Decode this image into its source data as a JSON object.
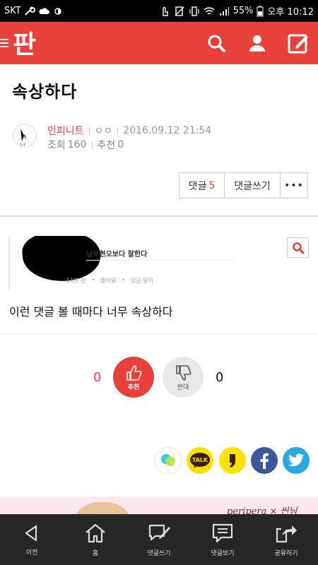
{
  "status_bar": {
    "carrier": "SKT",
    "battery": "55%",
    "time": "오후 10:12"
  },
  "header": {
    "logo_text": "판",
    "icons": [
      "menu-icon",
      "search-icon",
      "user-icon",
      "edit-icon"
    ]
  },
  "post": {
    "title": "속상하다",
    "author": "인피니트",
    "author_tag": "ㅇㅇ",
    "date": "2016.09.12 21:54",
    "views_label": "조회",
    "views": "160",
    "recommend_label": "추천",
    "recommend": "0",
    "body": "이런 댓글 볼 때마다 너무 속상하다"
  },
  "comment_bar": {
    "comments_label": "댓글",
    "comments_count": "5",
    "write_label": "댓글쓰기",
    "more_label": "•••"
  },
  "embedded_image": {
    "text": "남우현오보다 잘한다",
    "time": "11분 전",
    "like": "좋아요",
    "reply": "답글 달기"
  },
  "votes": {
    "up_count": "0",
    "up_label": "추천",
    "down_label": "반대",
    "down_count": "0"
  },
  "share": {
    "kakao_talk_label": "TALK"
  },
  "ad": {
    "brand": "peripera × 씬님"
  },
  "bottom_nav": [
    {
      "label": "이전"
    },
    {
      "label": "홈"
    },
    {
      "label": "댓글쓰기"
    },
    {
      "label": "댓글보기"
    },
    {
      "label": "공유하기"
    }
  ],
  "colors": {
    "brand": "#e8403a",
    "nav_bg": "#262626"
  }
}
